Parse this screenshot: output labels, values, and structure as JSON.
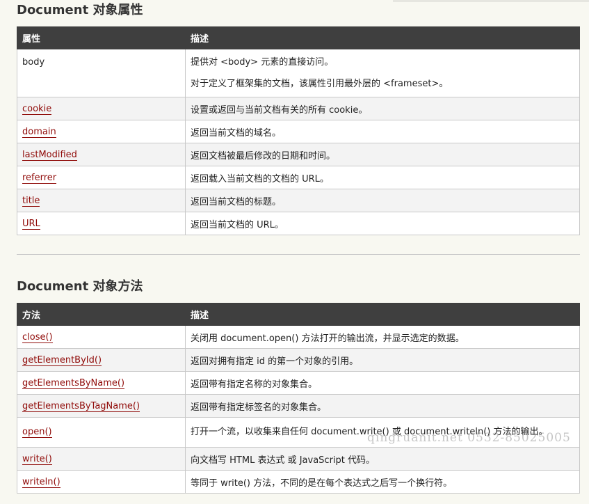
{
  "properties_section": {
    "title": "Document 对象属性",
    "header": [
      "属性",
      "描述"
    ],
    "rows": [
      {
        "name": "body",
        "desc": [
          "提供对 <body> 元素的直接访问。",
          "对于定义了框架集的文档，该属性引用最外层的 <frameset>。"
        ]
      },
      {
        "name": "cookie",
        "desc": "设置或返回与当前文档有关的所有 cookie。"
      },
      {
        "name": "domain",
        "desc": "返回当前文档的域名。"
      },
      {
        "name": "lastModified",
        "desc": "返回文档被最后修改的日期和时间。"
      },
      {
        "name": "referrer",
        "desc": "返回载入当前文档的文档的 URL。"
      },
      {
        "name": "title",
        "desc": "返回当前文档的标题。"
      },
      {
        "name": "URL",
        "desc": "返回当前文档的 URL。"
      }
    ]
  },
  "methods_section": {
    "title": "Document 对象方法",
    "header": [
      "方法",
      "描述"
    ],
    "rows": [
      {
        "name": "close()",
        "desc": "关闭用 document.open() 方法打开的输出流，并显示选定的数据。"
      },
      {
        "name": "getElementById()",
        "desc": "返回对拥有指定 id 的第一个对象的引用。"
      },
      {
        "name": "getElementsByName()",
        "desc": "返回带有指定名称的对象集合。"
      },
      {
        "name": "getElementsByTagName()",
        "desc": "返回带有指定标签名的对象集合。"
      },
      {
        "name": "open()",
        "desc": "打开一个流，以收集来自任何 document.write() 或 document.writeln() 方法的输出。"
      },
      {
        "name": "write()",
        "desc": "向文档写 HTML 表达式 或 JavaScript 代码。"
      },
      {
        "name": "writeln()",
        "desc": "等同于 write() 方法，不同的是在每个表达式之后写一个换行符。"
      }
    ]
  },
  "watermark": "qingruanit.net 0532-85025005",
  "colors": {
    "link": "#900b09",
    "header_bg": "#3f3f3f",
    "page_bg": "#f8f8f1"
  }
}
